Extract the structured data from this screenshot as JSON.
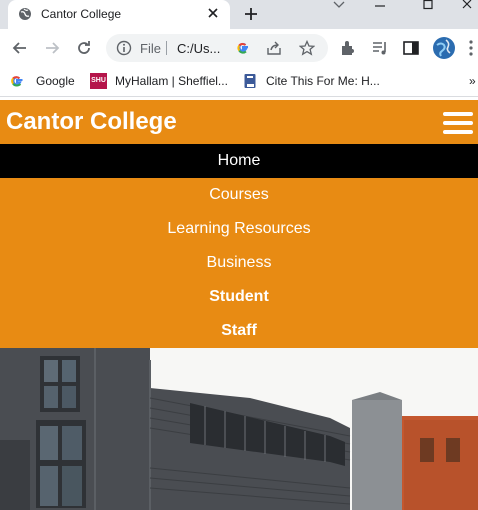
{
  "browser": {
    "tab_title": "Cantor College",
    "omnibox_scheme": "File",
    "omnibox_url": "C:/Us...",
    "bookmarks": [
      {
        "label": "Google",
        "icon": "google-icon"
      },
      {
        "label": "MyHallam | Sheffiel...",
        "icon": "shu-icon"
      },
      {
        "label": "Cite This For Me: H...",
        "icon": "bookmark-book-icon"
      }
    ],
    "more_bookmarks": "»",
    "shu_badge": "SHU"
  },
  "site": {
    "brand": "Cantor College",
    "nav": [
      {
        "label": "Home",
        "active": true,
        "bold": false
      },
      {
        "label": "Courses",
        "active": false,
        "bold": false
      },
      {
        "label": "Learning Resources",
        "active": false,
        "bold": false
      },
      {
        "label": "Business",
        "active": false,
        "bold": false
      },
      {
        "label": "Student",
        "active": false,
        "bold": true
      },
      {
        "label": "Staff",
        "active": false,
        "bold": true
      }
    ]
  },
  "colors": {
    "accent": "#e88b13",
    "active_bg": "#000000",
    "text": "#ffffff"
  }
}
